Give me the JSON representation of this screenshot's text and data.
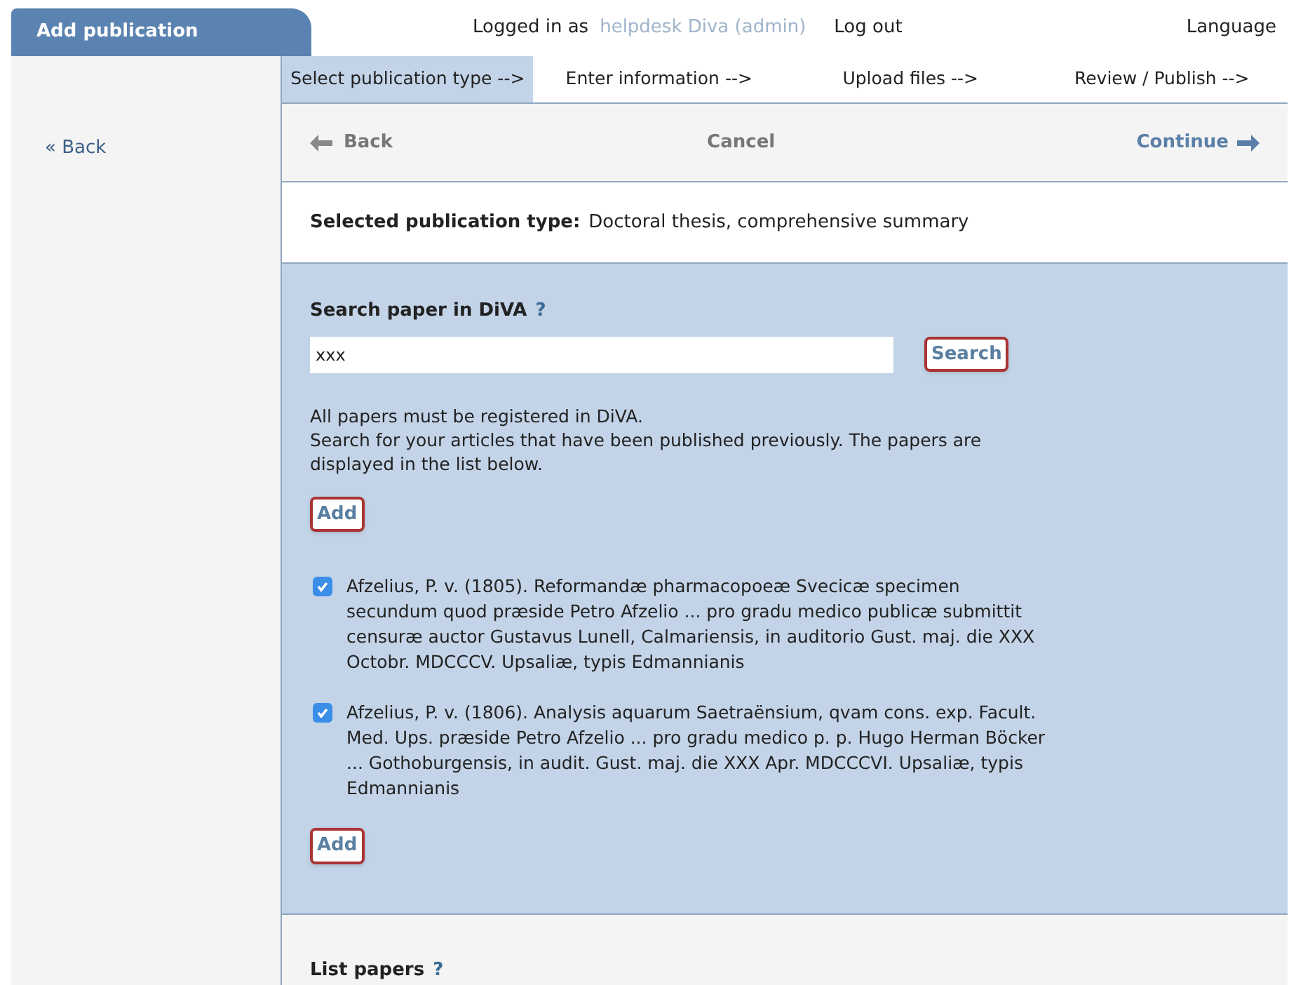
{
  "header": {
    "tab": "Add publication",
    "logged_in_label": "Logged in as",
    "user": "helpdesk Diva (admin)",
    "logout": "Log out",
    "language": "Language"
  },
  "sidebar": {
    "back": "« Back"
  },
  "steps": [
    {
      "label": "Select publication type -->",
      "selected": true
    },
    {
      "label": "Enter information -->",
      "selected": false
    },
    {
      "label": "Upload files -->",
      "selected": false
    },
    {
      "label": "Review / Publish -->",
      "selected": false
    }
  ],
  "nav": {
    "back": "Back",
    "cancel": "Cancel",
    "continue": "Continue"
  },
  "selected_type": {
    "label": "Selected publication type:",
    "value": "Doctoral thesis, comprehensive summary"
  },
  "search": {
    "title": "Search paper in DiVA",
    "help": "?",
    "value": "xxx",
    "button": "Search",
    "info": [
      "All papers must be registered in DiVA.",
      "Search for your articles that have been published previously. The papers are displayed in the list below."
    ],
    "add_top": "Add"
  },
  "papers": [
    {
      "text": "Afzelius, P. v. (1805). Reformandæ pharmacopoeæ Svecicæ specimen secundum quod præside Petro Afzelio ... pro gradu medico publicæ submittit censuræ auctor Gustavus Lunell, Calmariensis, in auditorio Gust. maj. die XXX Octobr. MDCCCV. Upsaliæ, typis Edmannianis",
      "checked": true
    },
    {
      "text": "Afzelius, P. v. (1806). Analysis aquarum Saetraënsium, qvam cons. exp. Facult. Med. Ups. præside Petro Afzelio ... pro gradu medico p. p. Hugo Herman Böcker ... Gothoburgensis, in audit. Gust. maj. die XXX Apr. MDCCCVI. Upsaliæ, typis Edmannianis",
      "checked": true
    }
  ],
  "add_bottom": "Add",
  "list_papers": {
    "title": "List papers",
    "help": "?"
  }
}
